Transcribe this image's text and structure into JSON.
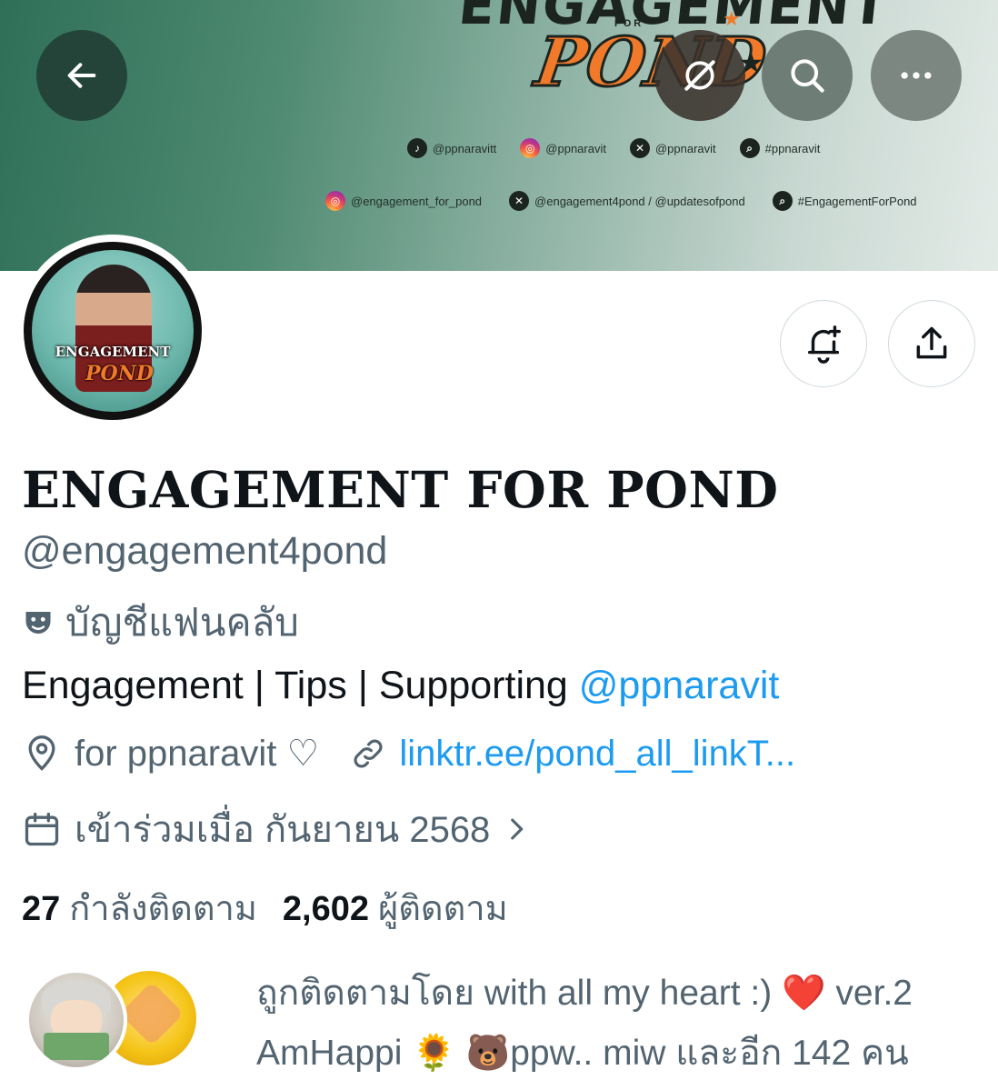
{
  "banner": {
    "art_title": "ENGAGEMENT",
    "art_for": "FOR",
    "art_pond": "POND",
    "social_row1": [
      {
        "icon": "tiktok-icon",
        "text": "@ppnaravitt"
      },
      {
        "icon": "instagram-icon",
        "text": "@ppnaravit"
      },
      {
        "icon": "x-icon",
        "text": "@ppnaravit"
      },
      {
        "icon": "search-icon",
        "text": "#ppnaravit"
      }
    ],
    "social_row2": [
      {
        "icon": "instagram-icon",
        "text": "@engagement_for_pond"
      },
      {
        "icon": "x-icon",
        "text": "@engagement4pond / @updatesofpond"
      },
      {
        "icon": "search-icon",
        "text": "#EngagementForPond"
      }
    ]
  },
  "avatar": {
    "text_top": "ENGAGEMENT",
    "text_bottom": "POND"
  },
  "profile": {
    "display_name": "ENGAGEMENT FOR POND",
    "handle": "@engagement4pond",
    "category": "บัญชีแฟนคลับ",
    "bio_text": "Engagement | Tips | Supporting ",
    "bio_mention": "@ppnaravit",
    "location": "for ppnaravit ♡",
    "link": "linktr.ee/pond_all_linkT...",
    "joined": "เข้าร่วมเมื่อ กันยายน 2568"
  },
  "stats": {
    "following_count": "27",
    "following_label": "กำลังติดตาม",
    "followers_count": "2,602",
    "followers_label": "ผู้ติดตาม"
  },
  "followed_by": {
    "text_line1": "ถูกติดตามโดย with all my heart :) ❤️ ver.2",
    "text_line2": "AmHappi 🌻 🐻ppw.. miw และอีก 142 คน"
  },
  "colors": {
    "accent": "#1d9bf0",
    "secondary_text": "#536471",
    "primary_text": "#0f1419"
  }
}
